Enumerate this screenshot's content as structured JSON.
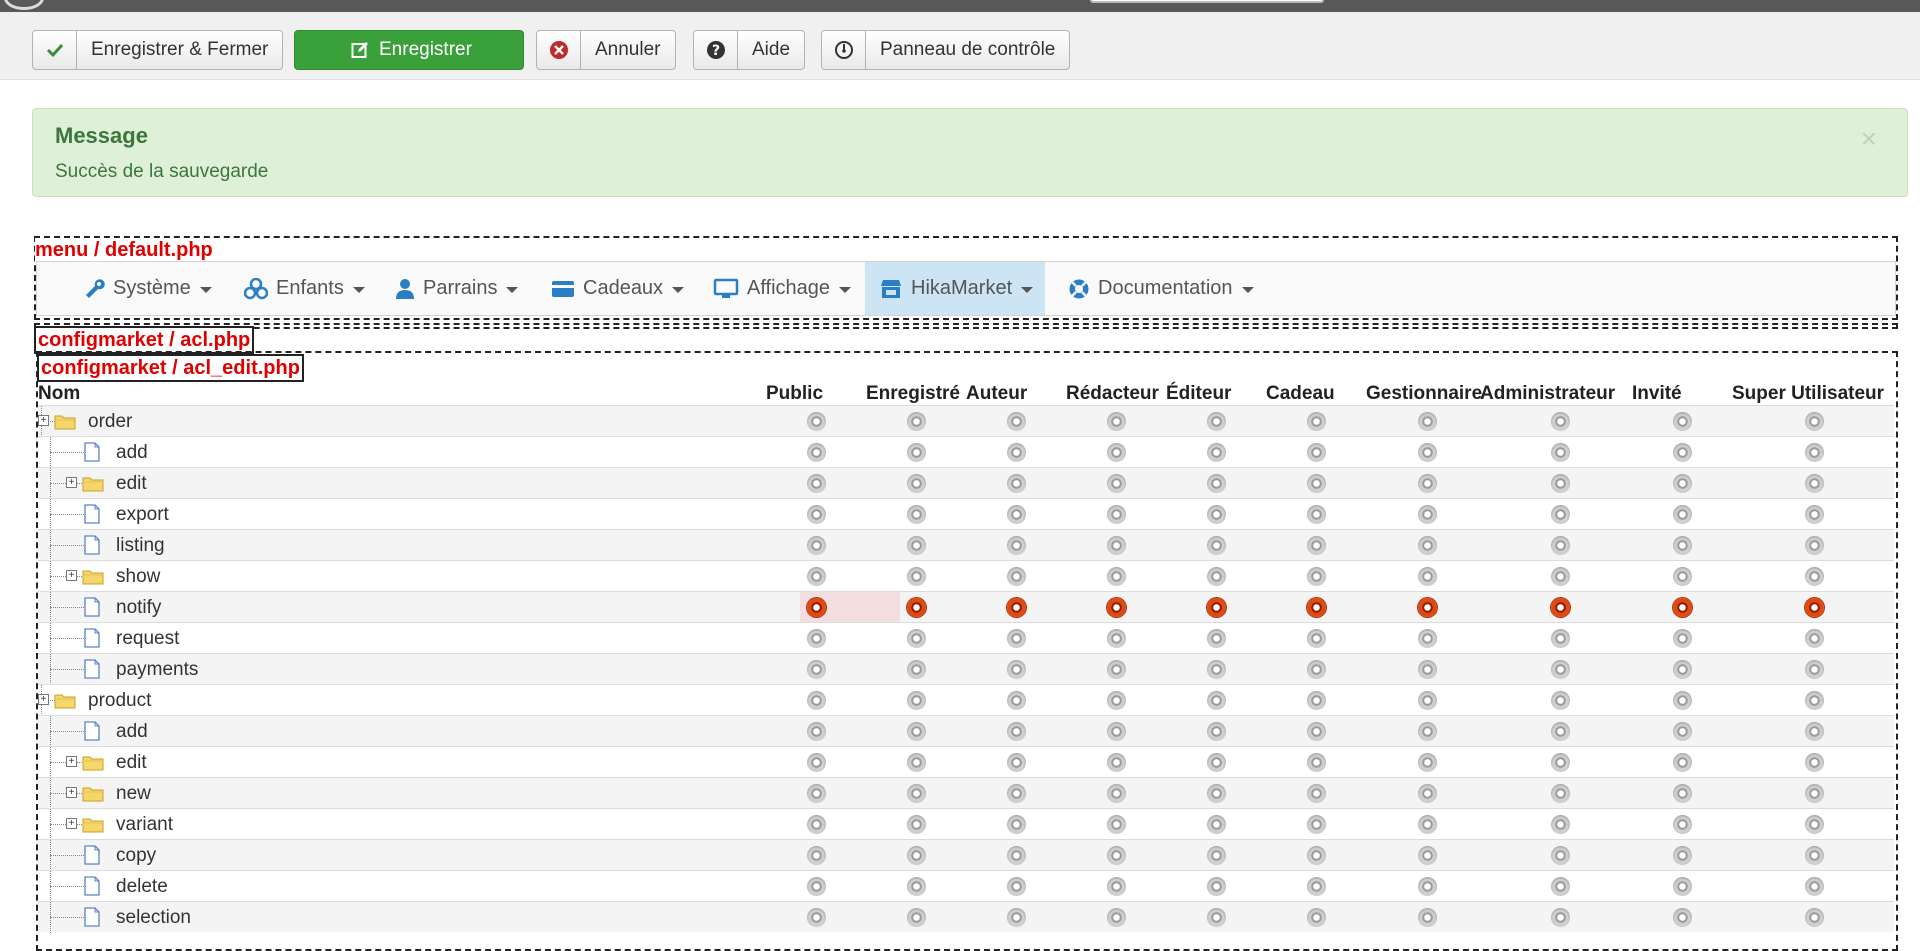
{
  "toolbar": {
    "save_close_label": "Enregistrer & Fermer",
    "save_label": "Enregistrer",
    "cancel_label": "Annuler",
    "help_label": "Aide",
    "control_panel_label": "Panneau de contrôle"
  },
  "alert": {
    "heading": "Message",
    "text": "Succès de la sauvegarde",
    "close": "×"
  },
  "debug_tags": {
    "menu": "menu / default.php",
    "acl": "configmarket / acl.php",
    "acl_edit": "configmarket / acl_edit.php"
  },
  "menu": {
    "items": [
      {
        "label": "Système",
        "icon": "wrench-icon"
      },
      {
        "label": "Enfants",
        "icon": "cubes-icon"
      },
      {
        "label": "Parrains",
        "icon": "user-icon"
      },
      {
        "label": "Cadeaux",
        "icon": "credit-card-icon"
      },
      {
        "label": "Affichage",
        "icon": "monitor-icon"
      },
      {
        "label": "HikaMarket",
        "icon": "store-icon",
        "active": true
      },
      {
        "label": "Documentation",
        "icon": "lifebuoy-icon"
      }
    ]
  },
  "acl_table": {
    "name_header": "Nom",
    "groups": [
      "Public",
      "Enregistré",
      "Auteur",
      "Rédacteur",
      "Éditeur",
      "Cadeau",
      "Gestionnaire",
      "Administrateur",
      "Invité",
      "Super Utilisateur"
    ],
    "rows": [
      {
        "label": "order",
        "level": 0,
        "type": "folder",
        "selected_index": null
      },
      {
        "label": "add",
        "level": 1,
        "type": "doc",
        "selected_index": null
      },
      {
        "label": "edit",
        "level": 1,
        "type": "folder",
        "selected_index": null
      },
      {
        "label": "export",
        "level": 1,
        "type": "doc",
        "selected_index": null
      },
      {
        "label": "listing",
        "level": 1,
        "type": "doc",
        "selected_index": null
      },
      {
        "label": "show",
        "level": 1,
        "type": "folder",
        "selected_index": null
      },
      {
        "label": "notify",
        "level": 1,
        "type": "doc",
        "selected_index": "all"
      },
      {
        "label": "request",
        "level": 1,
        "type": "doc",
        "selected_index": null
      },
      {
        "label": "payments",
        "level": 1,
        "type": "doc",
        "selected_index": null
      },
      {
        "label": "product",
        "level": 0,
        "type": "folder",
        "selected_index": null
      },
      {
        "label": "add",
        "level": 1,
        "type": "doc",
        "selected_index": null
      },
      {
        "label": "edit",
        "level": 1,
        "type": "folder",
        "selected_index": null
      },
      {
        "label": "new",
        "level": 1,
        "type": "folder",
        "selected_index": null
      },
      {
        "label": "variant",
        "level": 1,
        "type": "folder",
        "selected_index": null
      },
      {
        "label": "copy",
        "level": 1,
        "type": "doc",
        "selected_index": null
      },
      {
        "label": "delete",
        "level": 1,
        "type": "doc",
        "selected_index": null
      },
      {
        "label": "selection",
        "level": 1,
        "type": "doc",
        "selected_index": null
      }
    ]
  },
  "colors": {
    "success_bg": "#dff0d8",
    "success_text": "#3c763d",
    "save_green": "#3aa03a",
    "active_menu": "#cce4f4",
    "radio_on": "#e04a12",
    "debug_red": "#e10000"
  }
}
